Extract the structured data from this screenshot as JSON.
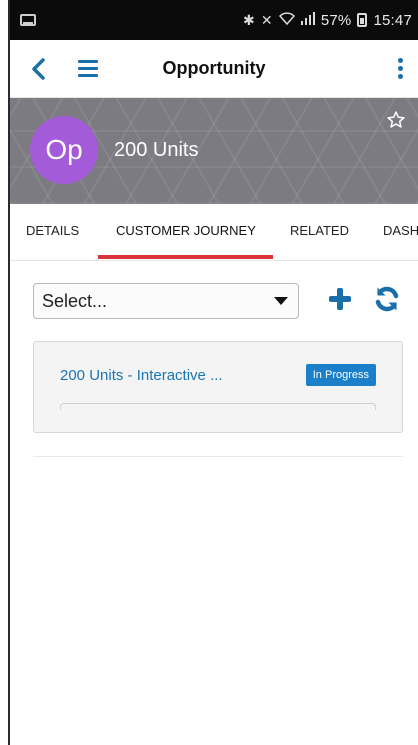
{
  "status_bar": {
    "icons": [
      "bluetooth-icon",
      "mute-icon",
      "wifi-icon",
      "signal-icon"
    ],
    "battery_percent": "57%",
    "time": "15:47"
  },
  "navbar": {
    "title": "Opportunity"
  },
  "record_header": {
    "avatar_initials": "Op",
    "avatar_color": "#a35bd9",
    "name": "200 Units"
  },
  "tabs": [
    {
      "label": "DETAILS"
    },
    {
      "label": "CUSTOMER JOURNEY"
    },
    {
      "label": "RELATED"
    },
    {
      "label": "DASH"
    }
  ],
  "toolbar": {
    "select_value": "Select..."
  },
  "journey_card": {
    "title": "200 Units - Interactive ...",
    "status_badge": "In Progress",
    "badge_color": "#1b7fc9"
  },
  "colors": {
    "accent_blue": "#1a6fa8",
    "active_tab_underline": "#d9343b"
  }
}
